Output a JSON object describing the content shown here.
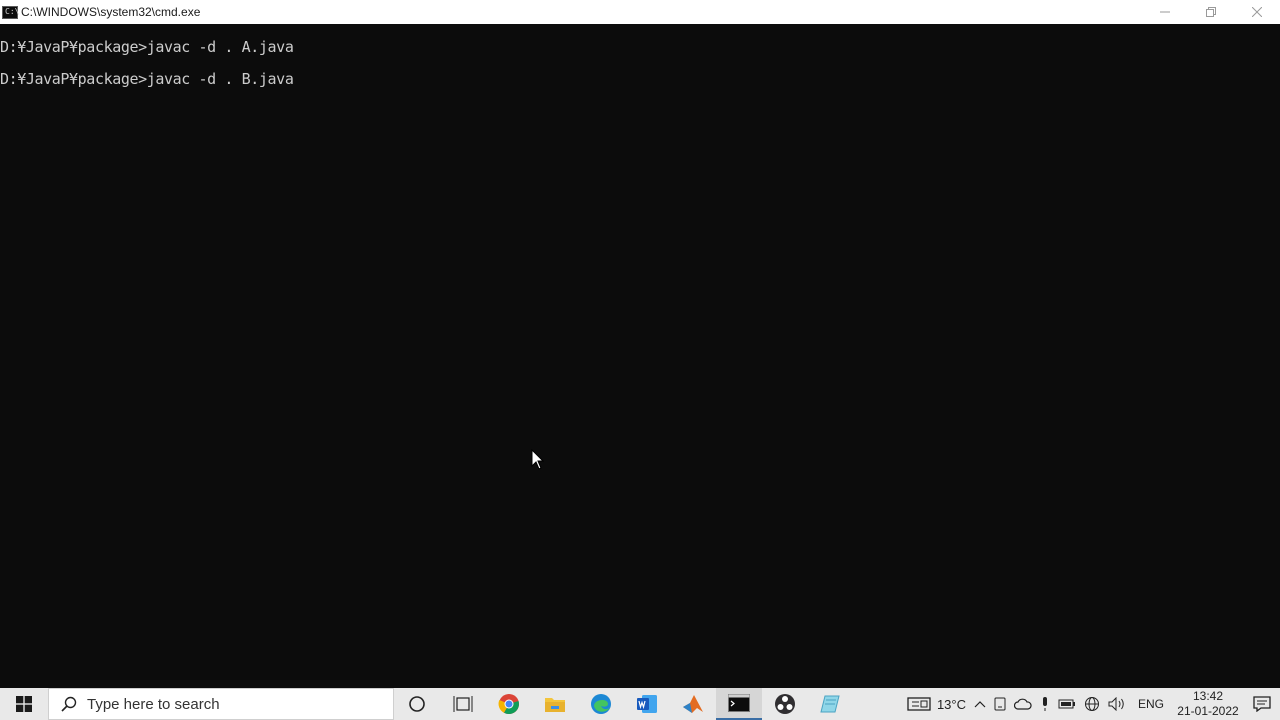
{
  "window": {
    "title": "C:\\WINDOWS\\system32\\cmd.exe",
    "icon_text": "C:\\",
    "controls": [
      "minimize",
      "restore",
      "close"
    ]
  },
  "console": {
    "lines": [
      "D:¥JavaP¥package>javac -d . A.java",
      "D:¥JavaP¥package>javac -d . B.java"
    ]
  },
  "taskbar": {
    "search_placeholder": "Type here to search",
    "pinned_icons": [
      "cortana-icon",
      "task-view-icon",
      "chrome-icon",
      "file-explorer-icon",
      "edge-icon",
      "word-icon",
      "matlab-icon",
      "cmd-icon",
      "obs-icon",
      "notepad-icon"
    ],
    "active_app": "cmd-icon",
    "weather": {
      "temperature": "13°C"
    },
    "language": "ENG",
    "clock": {
      "time": "13:42",
      "date": "21-01-2022"
    }
  },
  "colors": {
    "console_bg": "#0c0c0c",
    "console_text": "#cccccc",
    "taskbar_bg": "#e9e9e9",
    "titlebar_bg": "#ffffff"
  }
}
